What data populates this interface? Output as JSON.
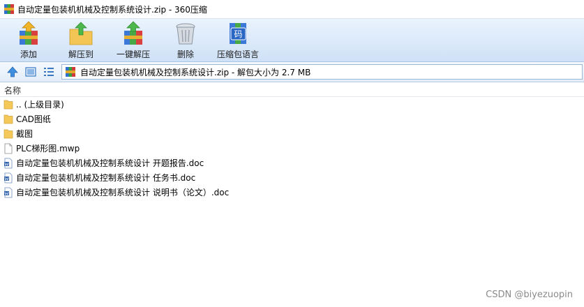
{
  "window": {
    "title": "自动定量包装机机械及控制系统设计.zip - 360压缩"
  },
  "toolbar": {
    "items": [
      {
        "label": "添加",
        "icon": "add-archive-icon"
      },
      {
        "label": "解压到",
        "icon": "extract-to-icon"
      },
      {
        "label": "一键解压",
        "icon": "one-click-extract-icon"
      },
      {
        "label": "删除",
        "icon": "trash-icon"
      },
      {
        "label": "压缩包语言",
        "icon": "archive-language-icon"
      }
    ],
    "language_icon_glyph": "码"
  },
  "address_bar": {
    "text": "自动定量包装机机械及控制系统设计.zip - 解包大小为 2.7 MB"
  },
  "file_list": {
    "column_name": "名称",
    "items": [
      {
        "name": ".. (上级目录)",
        "type": "folder"
      },
      {
        "name": "CAD图纸",
        "type": "folder"
      },
      {
        "name": "截图",
        "type": "folder"
      },
      {
        "name": "PLC梯形图.mwp",
        "type": "file"
      },
      {
        "name": "自动定量包装机机械及控制系统设计 开题报告.doc",
        "type": "doc"
      },
      {
        "name": "自动定量包装机机械及控制系统设计 任务书.doc",
        "type": "doc"
      },
      {
        "name": "自动定量包装机机械及控制系统设计 说明书（论文）.doc",
        "type": "doc"
      }
    ]
  },
  "watermark": "CSDN @biyezuopin",
  "colors": {
    "toolbar_top": "#eaf3fd",
    "toolbar_bottom": "#cfe1f7",
    "folder": "#f5c85a",
    "doc_blue": "#2b5fa8"
  }
}
